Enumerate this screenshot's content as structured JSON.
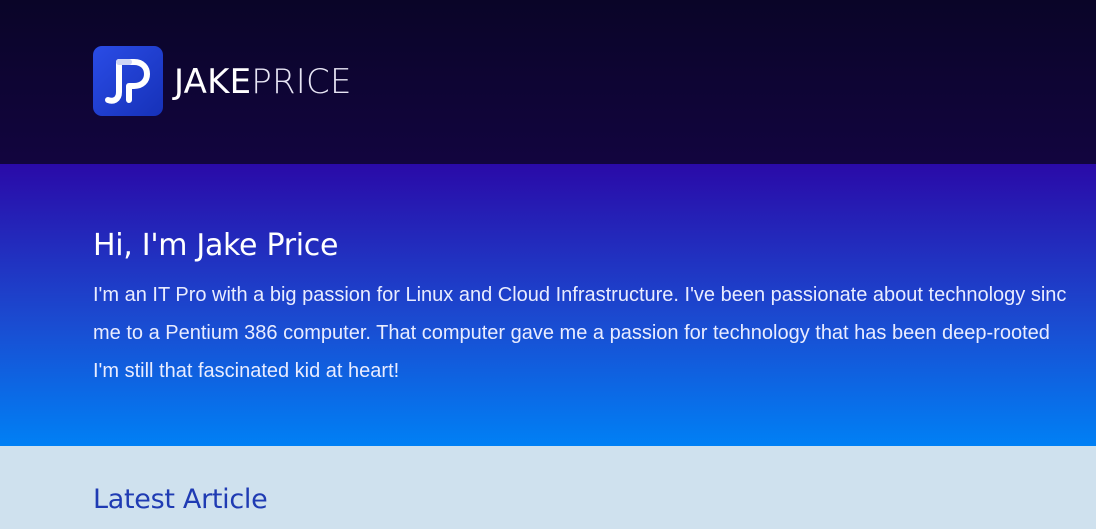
{
  "header": {
    "logo_icon": "jp-monogram-icon",
    "brand_first": "JAKE",
    "brand_last": "PRICE"
  },
  "hero": {
    "title": "Hi, I'm Jake Price",
    "body_lines": [
      "I'm an IT Pro with a big passion for Linux and Cloud Infrastructure. I've been passionate about technology sinc",
      "me to a Pentium 386 computer. That computer gave me a passion for technology that has been deep-rooted",
      "I'm still that fascinated kid at heart!"
    ]
  },
  "latest": {
    "title": "Latest Article"
  },
  "colors": {
    "header_bg": "#0a0528",
    "hero_top": "#2a0aa8",
    "hero_bottom": "#0080f5",
    "logo_bg": "#2a4ce6",
    "section_bg": "#cfe1ee",
    "section_heading": "#1f3bb3"
  }
}
